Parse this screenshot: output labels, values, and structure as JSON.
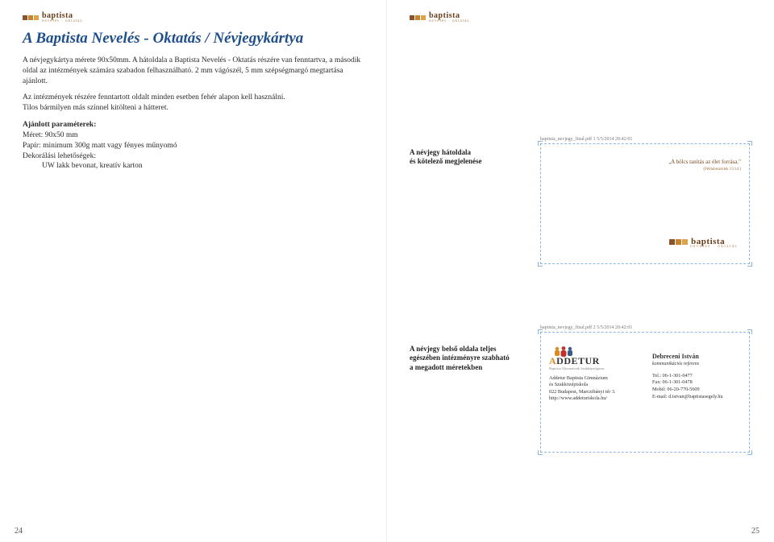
{
  "brand": {
    "name": "baptista",
    "sub": "nevelés · oktatás"
  },
  "title": "A Baptista Nevelés - Oktatás / Névjegykártya",
  "p1": "A névjegykártya mérete 90x50mm. A hátoldala a Baptista Nevelés - Oktatás részére van fenntartva, a második oldal az intézmények számára szabadon felhasználható.",
  "p2": "2 mm vágószél, 5 mm szépségmargó megtartása ajánlott.",
  "p3": "Az intézmények részére fenntartott oldalt minden esetben fehér alapon kell használni.",
  "p4": "Tilos bármilyen más színnel kitölteni a hátteret.",
  "params": {
    "hd": "Ajánlott paraméterek:",
    "l1": "Méret: 90x50 mm",
    "l2": "Papír: minimum 300g matt vagy fényes műnyomó",
    "l3": "Dekorálási lehetőségek:",
    "l4": "UW lakk bevonat, kreatív karton"
  },
  "rlabel1a": "A névjegy hátoldala",
  "rlabel1b": "és kötelező megjelenése",
  "rlabel2a": "A névjegy belső oldala teljes",
  "rlabel2b": "egészében intézményre szabható",
  "rlabel2c": "a megadott méretekben",
  "file1": "baptista_nevjegy_final.pdf   1   5/5/2014   20:42:01",
  "file2": "baptista_nevjegy_final.pdf   2   5/5/2014   20:42:01",
  "card1": {
    "quote": "„A bölcs tanítás az élet forrása.\"",
    "quoteref": "(Példabeszédek 13:14.)"
  },
  "card2": {
    "logo": "ADDETUR",
    "logosub": "Baptista Alternatívák Szakképzőgimn.",
    "org1": "Addetur Baptista Gimnázium",
    "org2": "és Szakközépiskola",
    "addr": "022 Budapest, Marczibányi tér 3.",
    "url": "http://www.addeturiskola.hu/",
    "name": "Debreceni István",
    "role": "kommunikációs referens",
    "tel": "Tel.: 06-1-301-0477",
    "fax": "Fax: 06-1-301-0478",
    "mob": "Mobil: 06-20-770-5609",
    "email": "E-mail: d.istvan@baptistasegely.hu"
  },
  "pages": {
    "left": "24",
    "right": "25"
  }
}
